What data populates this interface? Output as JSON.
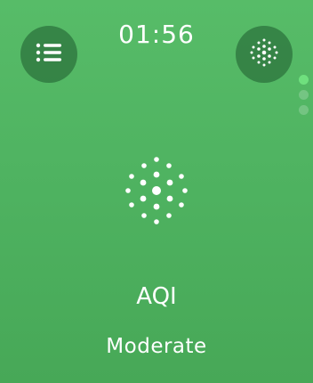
{
  "status_bar": {
    "time": "01:56"
  },
  "buttons": {
    "left_icon": "list-icon",
    "right_icon": "sensor-dots-icon"
  },
  "pager": {
    "page_count": 3,
    "active_index": 0
  },
  "main": {
    "icon": "air-quality-icon",
    "title": "AQI",
    "status": "Moderate"
  },
  "colors": {
    "background": "#4fb361",
    "button_bg": "#2f7d42",
    "active_dot": "#6fe07e",
    "text": "#ffffff"
  }
}
